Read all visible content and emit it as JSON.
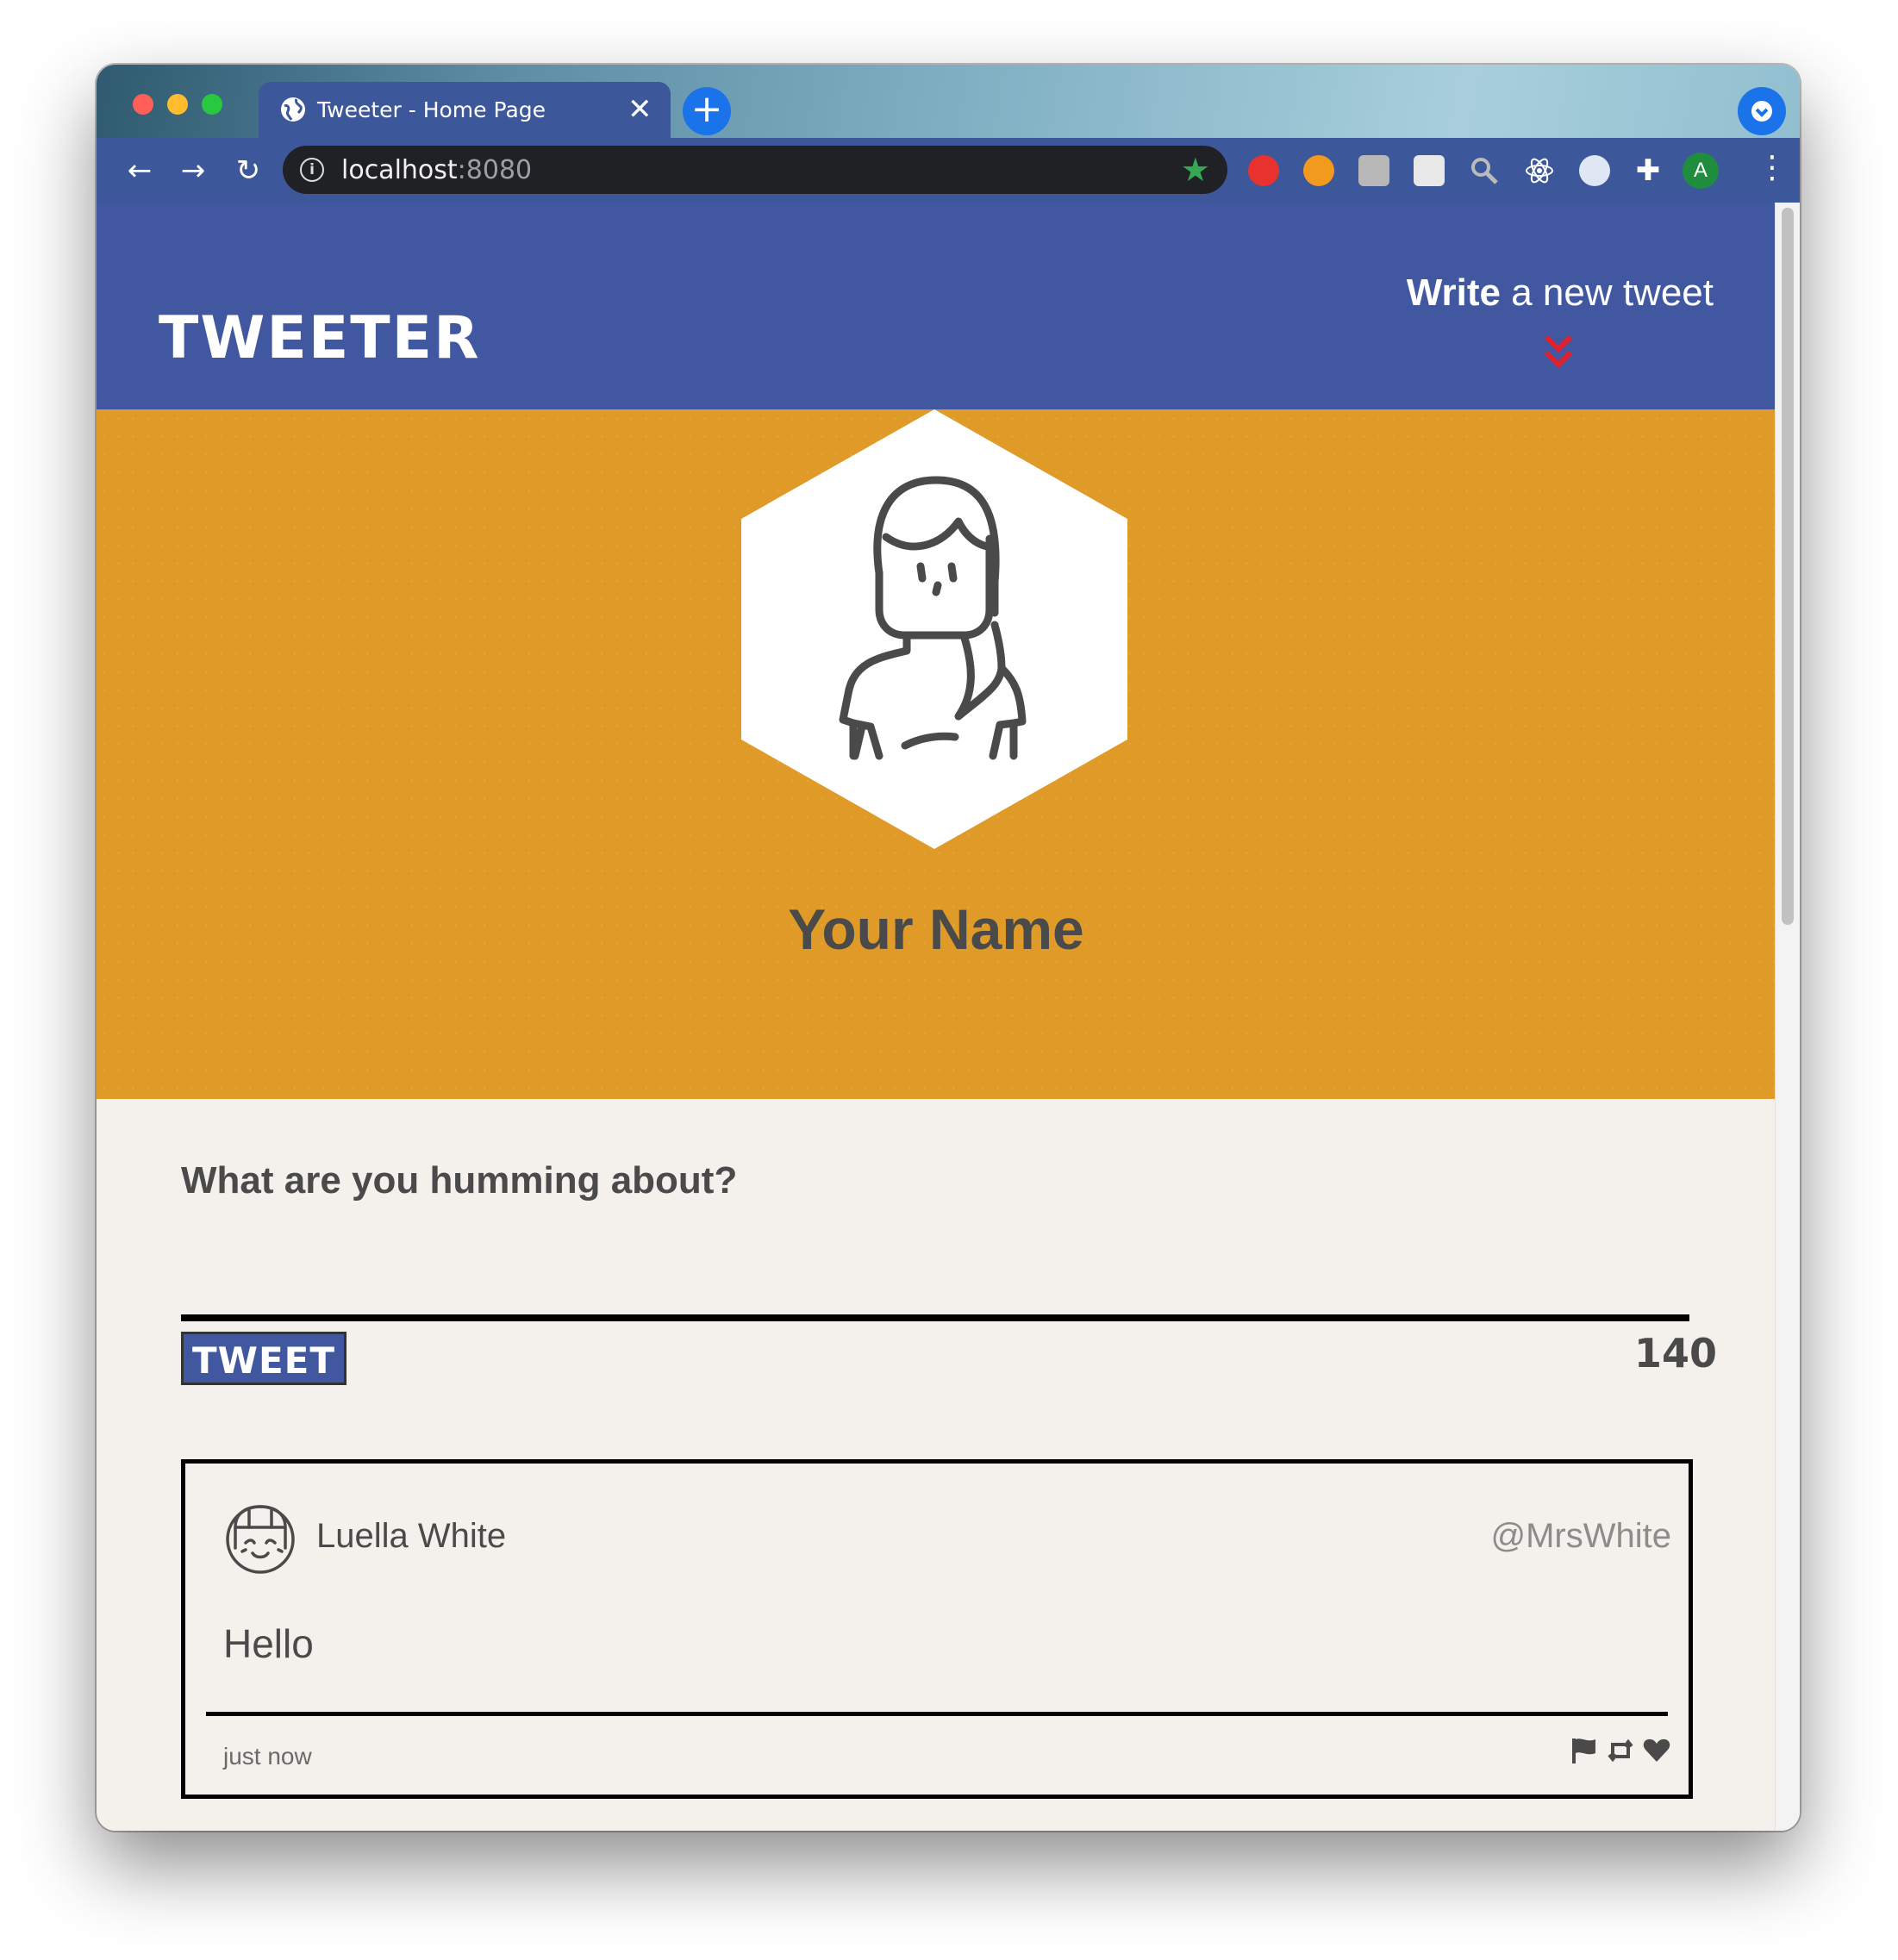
{
  "browser": {
    "tab_title": "Tweeter - Home Page",
    "tab_close": "✕",
    "new_tab": "+",
    "url_host": "localhost",
    "url_port": ":8080",
    "profile_initial": "A",
    "nav": {
      "back": "←",
      "forward": "→",
      "reload": "↻"
    },
    "menu": "⋮"
  },
  "nav": {
    "logo": "TWEETER",
    "compose_bold": "Write",
    "compose_rest": " a new tweet"
  },
  "profile": {
    "name": "Your Name"
  },
  "composer": {
    "heading": "What are you humming about?",
    "button_label": "TWEET",
    "counter": "140"
  },
  "tweets": [
    {
      "name": "Luella White",
      "handle": "@MrsWhite",
      "content": "Hello",
      "time": "just now"
    }
  ],
  "colors": {
    "nav_bg": "#4158a0",
    "profile_bg": "#e09a27",
    "page_bg": "#f4f1ec",
    "accent_red": "#e0202e"
  },
  "icons": [
    "globe-icon",
    "info-icon",
    "star-icon",
    "chevron-down-icon",
    "avatar-icon",
    "flag-icon",
    "retweet-icon",
    "heart-icon"
  ]
}
